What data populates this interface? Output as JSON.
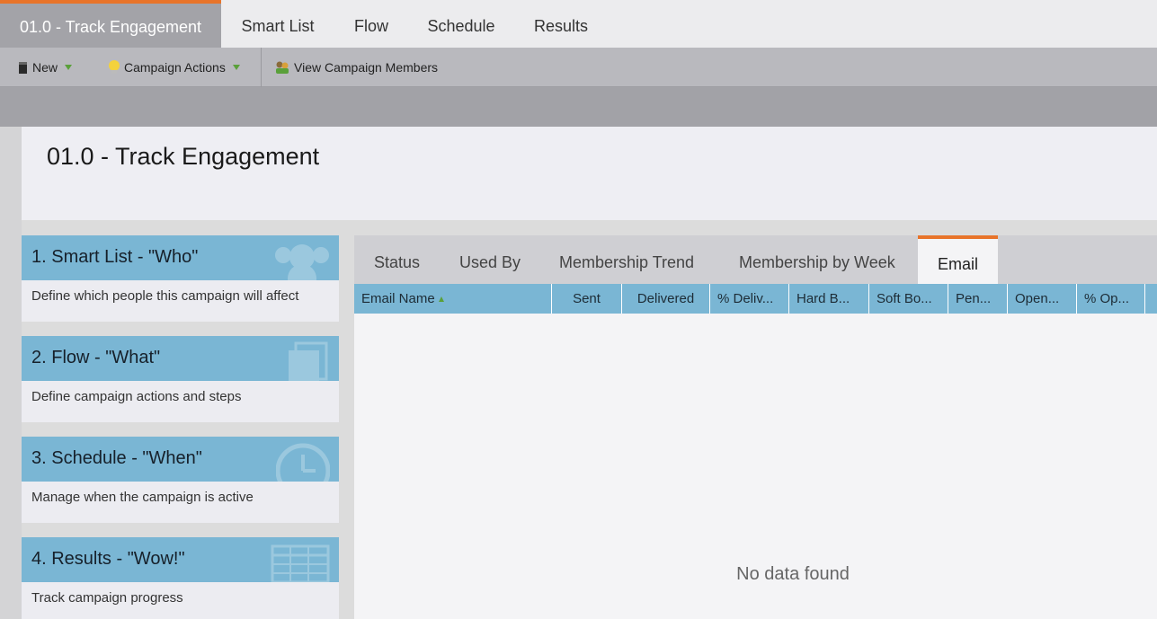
{
  "top_tabs": [
    "01.0 - Track Engagement",
    "Smart List",
    "Flow",
    "Schedule",
    "Results"
  ],
  "toolbar": {
    "new_label": "New",
    "campaign_actions_label": "Campaign Actions",
    "view_members_label": "View Campaign Members"
  },
  "page_title": "01.0 - Track Engagement",
  "cards": [
    {
      "title": "1. Smart List - \"Who\"",
      "desc": "Define which people this campaign will affect",
      "icon": "people-icon"
    },
    {
      "title": "2. Flow - \"What\"",
      "desc": "Define campaign actions and steps",
      "icon": "stack-icon"
    },
    {
      "title": "3. Schedule - \"When\"",
      "desc": "Manage when the campaign is active",
      "icon": "clock-icon"
    },
    {
      "title": "4. Results - \"Wow!\"",
      "desc": "Track campaign progress",
      "icon": "table-icon"
    }
  ],
  "sub_tabs": [
    "Status",
    "Used By",
    "Membership Trend",
    "Membership by Week",
    "Email"
  ],
  "active_sub_tab": "Email",
  "columns": [
    "Email Name",
    "Sent",
    "Delivered",
    "% Deliv...",
    "Hard B...",
    "Soft Bo...",
    "Pen...",
    "Open...",
    "% Op..."
  ],
  "empty_message": "No data found",
  "colors": {
    "accent": "#e8742a",
    "header_blue": "#7ab6d4",
    "toolbar_gray": "#b9b9be"
  }
}
